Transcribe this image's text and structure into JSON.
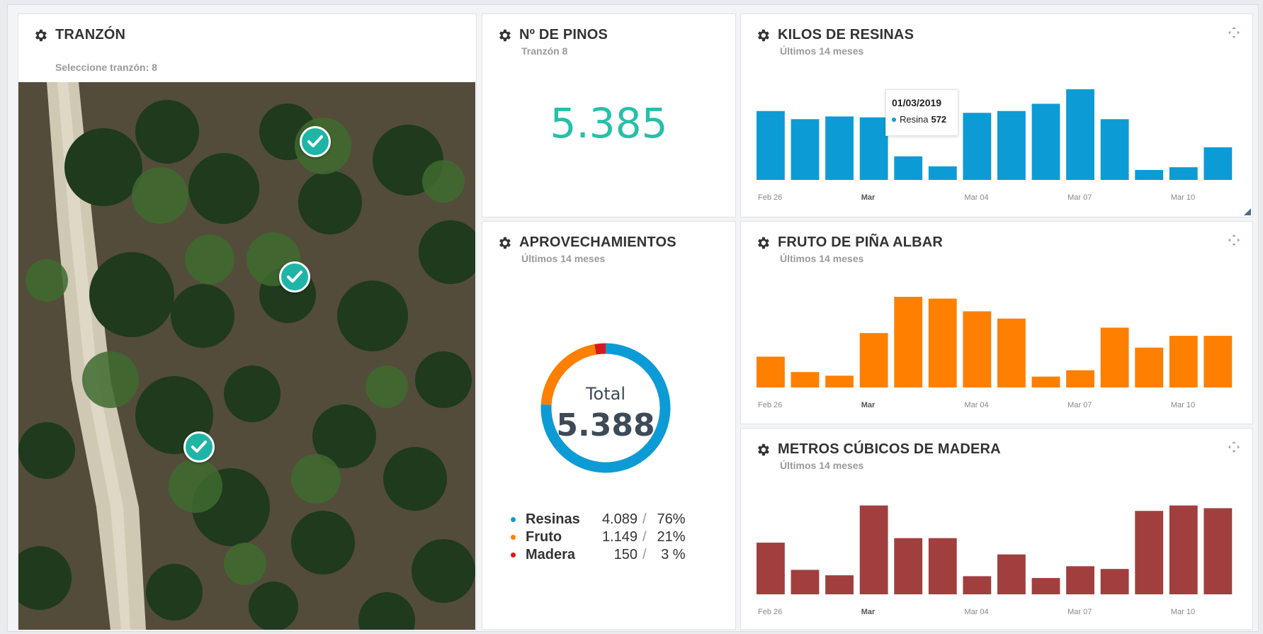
{
  "colors": {
    "accent": "#26c0a8",
    "resinas": "#0d9bd6",
    "fruto": "#ff7f00",
    "madera": "#a13f3f",
    "tooltip_resinas": "#0d9bd6"
  },
  "tranzon": {
    "title": "TRANZÓN",
    "subtitle": "Seleccione tranzón: 8",
    "markers": [
      "check-icon",
      "check-icon",
      "check-icon"
    ]
  },
  "pinos": {
    "title": "Nº DE PINOS",
    "subtitle": "Tranzón 8",
    "value": "5.385"
  },
  "aprovechamientos": {
    "title": "APROVECHAMIENTOS",
    "subtitle": "Últimos 14 meses",
    "total_label": "Total",
    "total_value": "5.388",
    "legend": [
      {
        "name": "Resinas",
        "value": "4.089",
        "sep": "/",
        "pct": "76%",
        "color": "#0d9bd6"
      },
      {
        "name": "Fruto",
        "value": "1.149",
        "sep": "/",
        "pct": "21%",
        "color": "#ff7f00"
      },
      {
        "name": "Madera",
        "value": "150",
        "sep": "/",
        "pct": "3 %",
        "color": "#d7191c"
      }
    ]
  },
  "resinas": {
    "title": "KILOS DE RESINAS",
    "subtitle": "Últimos 14 meses",
    "tooltip": {
      "date": "01/03/2019",
      "series": "Resina",
      "value": "572"
    }
  },
  "fruto": {
    "title": "FRUTO DE PIÑA ALBAR",
    "subtitle": "Últimos 14 meses"
  },
  "madera": {
    "title": "METROS CÚBICOS DE MADERA",
    "subtitle": "Últimos 14 meses"
  },
  "chart_data": [
    {
      "type": "bar",
      "title": "KILOS DE RESINAS",
      "x_ticks": [
        "Feb 26",
        "Mar",
        "Mar 04",
        "Mar 07",
        "Mar 10"
      ],
      "values": [
        76,
        67,
        70,
        69,
        26,
        15,
        74,
        76,
        84,
        100,
        67,
        11,
        14,
        36
      ],
      "ylim": [
        0,
        100
      ],
      "color": "#0d9bd6"
    },
    {
      "type": "bar",
      "title": "FRUTO DE PIÑA ALBAR",
      "x_ticks": [
        "Feb 26",
        "Mar",
        "Mar 04",
        "Mar 07",
        "Mar 10"
      ],
      "values": [
        34,
        17,
        13,
        60,
        100,
        98,
        84,
        76,
        12,
        19,
        66,
        44,
        57,
        57
      ],
      "ylim": [
        0,
        100
      ],
      "color": "#ff7f00"
    },
    {
      "type": "bar",
      "title": "METROS CÚBICOS DE MADERA",
      "x_ticks": [
        "Feb 26",
        "Mar",
        "Mar 04",
        "Mar 07",
        "Mar 10"
      ],
      "values": [
        57,
        27,
        21,
        98,
        62,
        62,
        20,
        44,
        18,
        31,
        28,
        92,
        98,
        95
      ],
      "ylim": [
        0,
        100
      ],
      "color": "#a13f3f"
    },
    {
      "type": "pie",
      "title": "APROVECHAMIENTOS",
      "categories": [
        "Resinas",
        "Fruto",
        "Madera"
      ],
      "values": [
        4089,
        1149,
        150
      ],
      "colors": [
        "#0d9bd6",
        "#ff7f00",
        "#d7191c"
      ]
    }
  ]
}
